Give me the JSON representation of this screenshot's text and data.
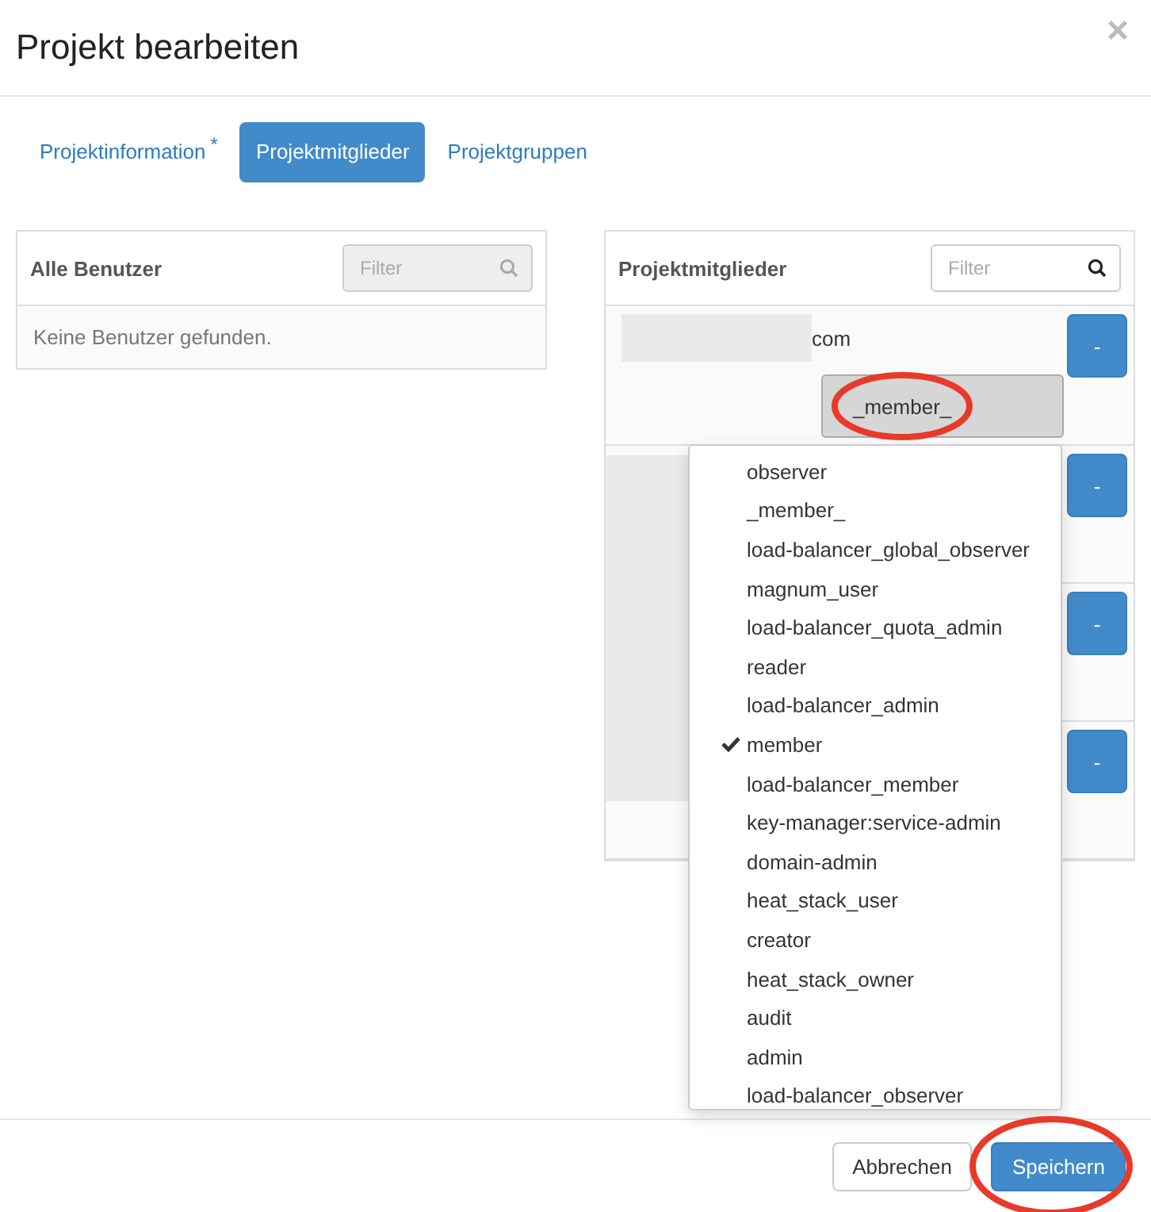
{
  "dialog": {
    "title": "Projekt bearbeiten",
    "close": "×"
  },
  "tabs": [
    {
      "label": "Projektinformation",
      "mark": "*",
      "selected": false
    },
    {
      "label": "Projektmitglieder",
      "selected": true
    },
    {
      "label": "Projektgruppen",
      "selected": false
    }
  ],
  "all_users": {
    "title": "Alle Benutzer",
    "filter": {
      "placeholder": "Filter",
      "disabled": true
    },
    "empty_text": "Keine Benutzer gefunden."
  },
  "members": {
    "title": "Projektmitglieder",
    "filter": {
      "placeholder": "Filter",
      "disabled": false
    },
    "rows": [
      {
        "name": "com",
        "role": "_member_",
        "highlighted": true,
        "remove": "-"
      },
      {
        "remove": "-"
      },
      {
        "remove": "-"
      },
      {
        "remove": "-"
      }
    ]
  },
  "role_menu": {
    "items": [
      {
        "label": "observer",
        "selected": false
      },
      {
        "label": "_member_",
        "selected": false
      },
      {
        "label": "load-balancer_global_observer",
        "selected": false
      },
      {
        "label": "magnum_user",
        "selected": false
      },
      {
        "label": "load-balancer_quota_admin",
        "selected": false
      },
      {
        "label": "reader",
        "selected": false
      },
      {
        "label": "load-balancer_admin",
        "selected": false
      },
      {
        "label": "member",
        "selected": true
      },
      {
        "label": "load-balancer_member",
        "selected": false
      },
      {
        "label": "key-manager:service-admin",
        "selected": false
      },
      {
        "label": "domain-admin",
        "selected": false
      },
      {
        "label": "heat_stack_user",
        "selected": false
      },
      {
        "label": "creator",
        "selected": false
      },
      {
        "label": "heat_stack_owner",
        "selected": false
      },
      {
        "label": "audit",
        "selected": false
      },
      {
        "label": "admin",
        "selected": false
      },
      {
        "label": "load-balancer_observer",
        "selected": false
      }
    ]
  },
  "buttons": [
    {
      "label": "Abbrechen",
      "kind": "default",
      "highlighted": false
    },
    {
      "label": "Speichern",
      "kind": "primary",
      "highlighted": true
    }
  ]
}
